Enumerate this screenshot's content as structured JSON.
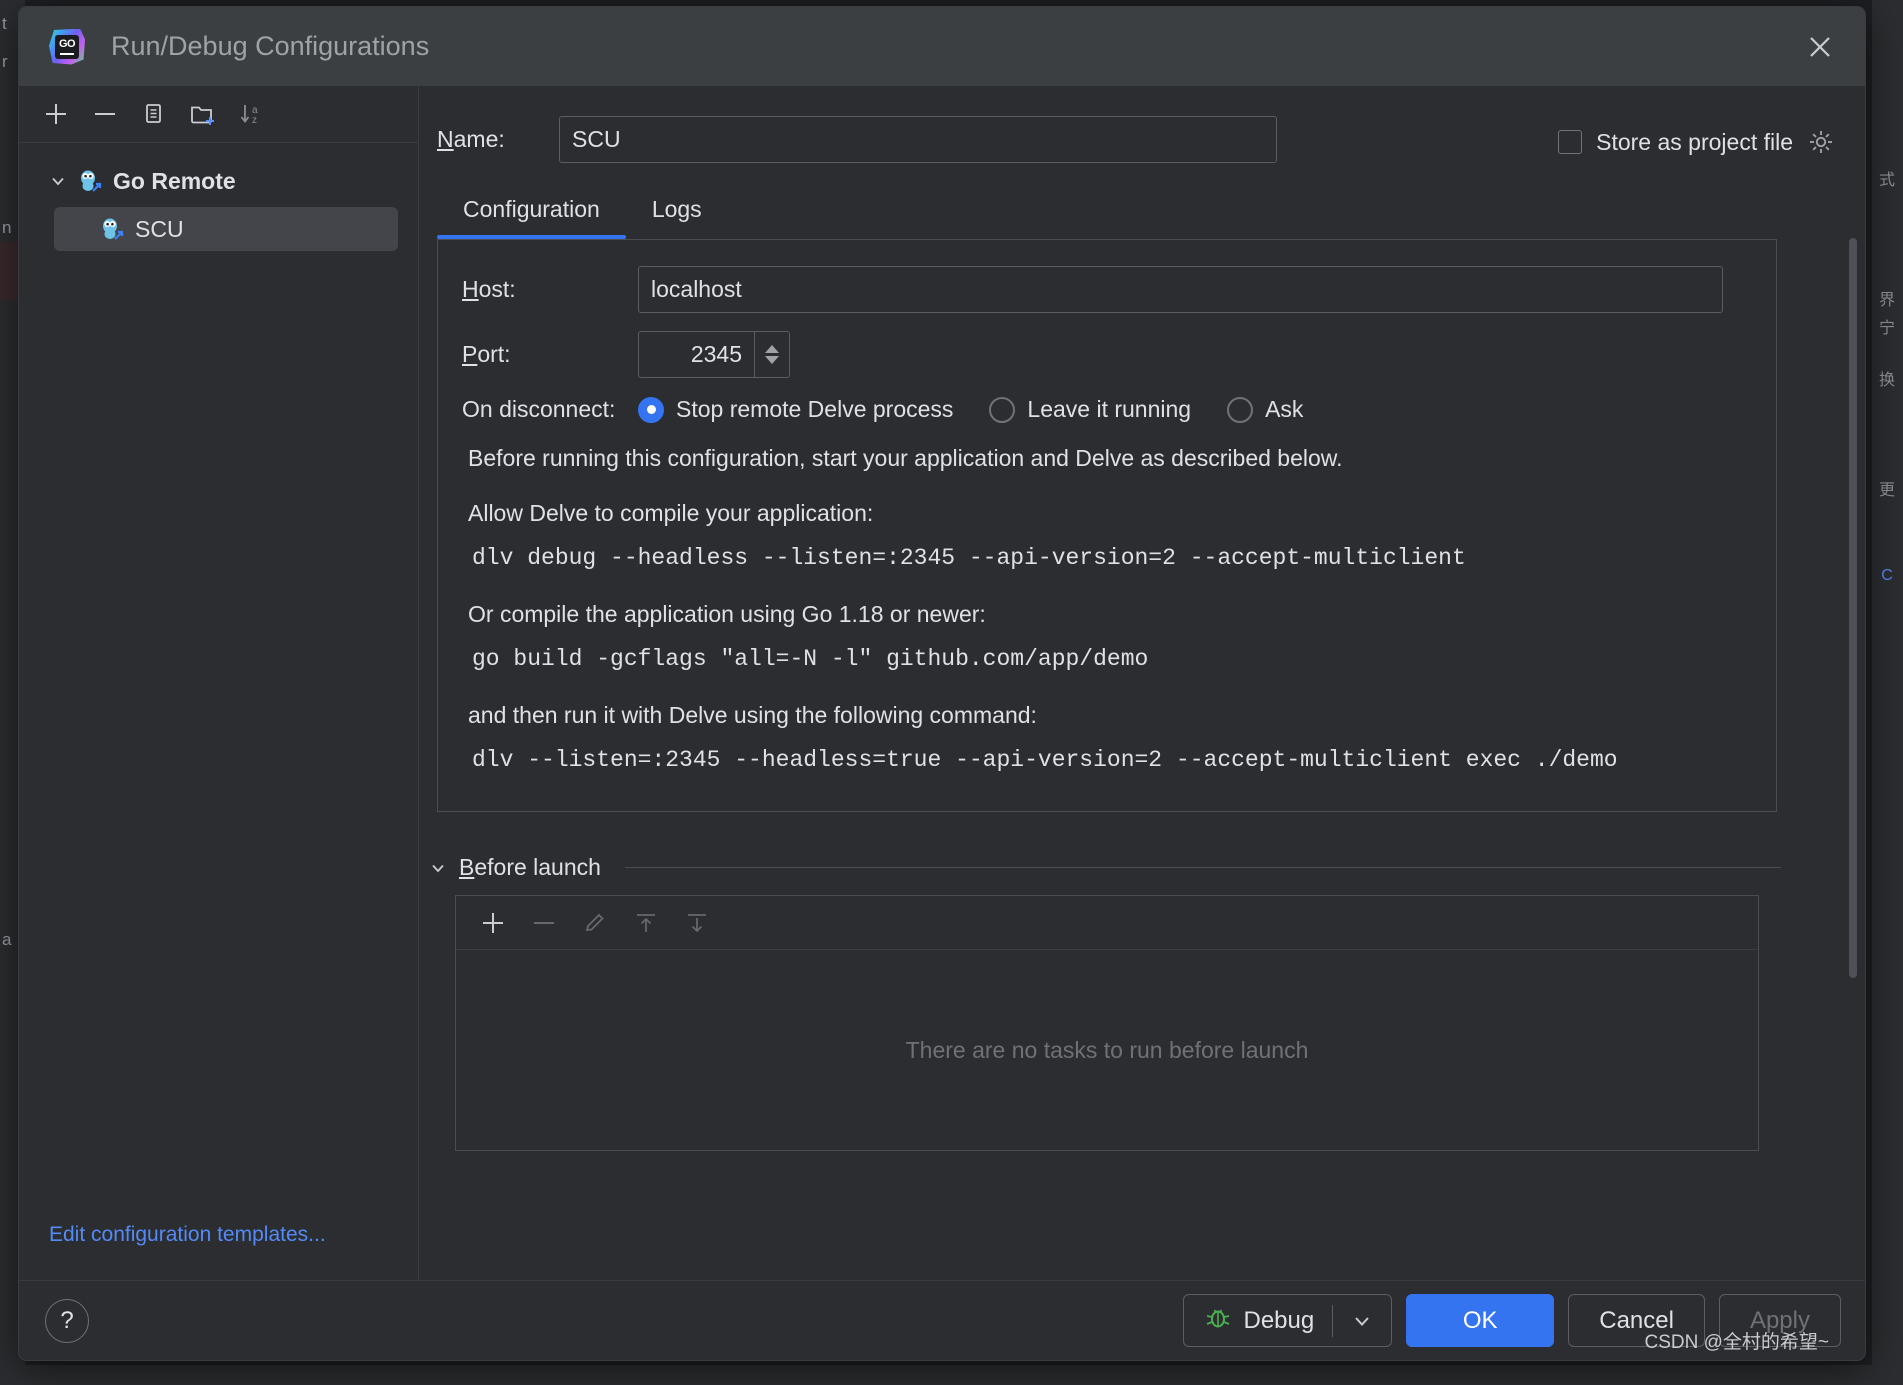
{
  "window": {
    "title": "Run/Debug Configurations",
    "app_icon": "goland-icon",
    "close_icon": "close-icon"
  },
  "left_pane": {
    "toolbar": [
      {
        "name": "add-configuration-button",
        "icon": "plus-icon"
      },
      {
        "name": "remove-configuration-button",
        "icon": "minus-icon"
      },
      {
        "name": "copy-configuration-button",
        "icon": "copy-icon"
      },
      {
        "name": "new-folder-button",
        "icon": "folder-plus-icon"
      },
      {
        "name": "sort-configurations-button",
        "icon": "sort-az-icon"
      }
    ],
    "tree": {
      "group_label": "Go Remote",
      "child_label": "SCU"
    },
    "edit_templates_link": "Edit configuration templates..."
  },
  "header": {
    "name_label": "Name:",
    "name_mnemonic": "N",
    "name_value": "SCU",
    "store_as_project_file_label": "Store as project file",
    "store_as_project_file_checked": false,
    "gear_icon": "gear-icon"
  },
  "tabs": [
    {
      "label": "Configuration",
      "active": true
    },
    {
      "label": "Logs",
      "active": false
    }
  ],
  "configuration": {
    "host_label": "Host:",
    "host_mnemonic": "H",
    "host_value": "localhost",
    "port_label": "Port:",
    "port_mnemonic": "P",
    "port_value": "2345",
    "on_disconnect_label": "On disconnect:",
    "on_disconnect_options": [
      {
        "label": "Stop remote Delve process",
        "selected": true
      },
      {
        "label": "Leave it running",
        "selected": false
      },
      {
        "label": "Ask",
        "selected": false
      }
    ],
    "intro_text": "Before running this configuration, start your application and Delve as described below.",
    "section_1_heading": "Allow Delve to compile your application:",
    "section_1_command": "dlv debug --headless --listen=:2345 --api-version=2 --accept-multiclient",
    "section_2_heading": "Or compile the application using Go 1.18 or newer:",
    "section_2_command": "go build -gcflags \"all=-N -l\" github.com/app/demo",
    "section_3_heading": "and then run it with Delve using the following command:",
    "section_3_command": "dlv --listen=:2345 --headless=true --api-version=2 --accept-multiclient exec ./demo"
  },
  "before_launch": {
    "title": "Before launch",
    "mnemonic": "B",
    "expanded": true,
    "toolbar": [
      {
        "name": "add-task-button",
        "icon": "plus-icon",
        "enabled": true
      },
      {
        "name": "remove-task-button",
        "icon": "minus-icon",
        "enabled": false
      },
      {
        "name": "edit-task-button",
        "icon": "pencil-icon",
        "enabled": false
      },
      {
        "name": "move-task-up-button",
        "icon": "arrow-up-icon",
        "enabled": false
      },
      {
        "name": "move-task-down-button",
        "icon": "arrow-down-icon",
        "enabled": false
      }
    ],
    "empty_message": "There are no tasks to run before launch"
  },
  "footer": {
    "help_label": "?",
    "debug_label": "Debug",
    "debug_icon": "bug-icon",
    "dropdown_icon": "chevron-down-icon",
    "ok_label": "OK",
    "cancel_label": "Cancel",
    "apply_label": "Apply",
    "apply_enabled": false
  },
  "watermark": "CSDN @全村的希望~",
  "background": {
    "left_glyphs": [
      "t",
      "r",
      "n",
      "a"
    ],
    "right_glyphs": [
      "式",
      "界",
      "宁",
      "换",
      "更",
      "C"
    ]
  },
  "colors": {
    "accent_blue": "#3574f0",
    "link_blue": "#548af7",
    "dialog_bg": "#2b2d30",
    "titlebar_bg": "#3c3f41",
    "text_primary": "#dfe1e5",
    "text_muted": "#6e7277",
    "bug_green": "#4caf50"
  }
}
